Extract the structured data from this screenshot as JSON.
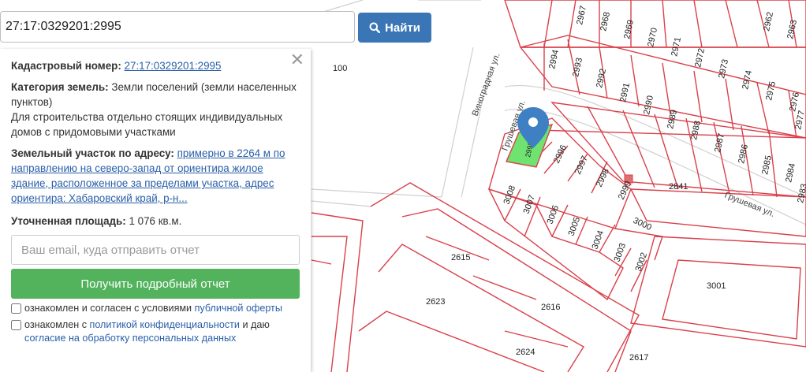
{
  "search": {
    "value": "27:17:0329201:2995",
    "button_label": "Найти"
  },
  "panel": {
    "cadastral_label": "Кадастровый номер:",
    "cadastral_value": "27:17:0329201:2995",
    "category_label": "Категория земель:",
    "category_value": "Земли поселений (земли населенных пунктов)",
    "purpose": "Для строительства отдельно стоящих индивидуальных домов с придомовыми участками",
    "address_label": "Земельный участок по адресу:",
    "address_value": "примерно в 2264 м по направлению на северо-запад от ориентира жилое здание, расположенное за пределами участка, адрес ориентира: Хабаровский край, р-н...",
    "area_label": "Уточненная площадь:",
    "area_value": "1 076 кв.м.",
    "email_placeholder": "Ваш email, куда отправить отчет",
    "report_button": "Получить подробный отчет",
    "consent1_text": "ознакомлен и согласен с условиями",
    "consent1_link": "публичной оферты",
    "consent2_text_a": "ознакомлен с",
    "consent2_link_a": "политикой конфиденциальности",
    "consent2_text_b": "и даю",
    "consent2_link_b": "согласие на обработку персональных данных"
  },
  "map": {
    "streets": [
      "Виноградная ул.",
      "Грушевая ул.",
      "Грушевая ул."
    ],
    "plots": [
      "2967",
      "2968",
      "2969",
      "2970",
      "2971",
      "2972",
      "2973",
      "2974",
      "2975",
      "2976",
      "2977",
      "2962",
      "2963",
      "2994",
      "2993",
      "2992",
      "2991",
      "2990",
      "2989",
      "2988",
      "2987",
      "2986",
      "2985",
      "2984",
      "2983",
      "2995",
      "2996",
      "2997",
      "2998",
      "2999",
      "3008",
      "3007",
      "3006",
      "3005",
      "3004",
      "3003",
      "3002",
      "3000",
      "2841",
      "3001",
      "2615",
      "2616",
      "2617",
      "2623",
      "2624",
      "100"
    ],
    "colors": {
      "plot_line": "#d9404a",
      "highlight": "#6fe26f",
      "marker": "#3f7fc4"
    }
  }
}
